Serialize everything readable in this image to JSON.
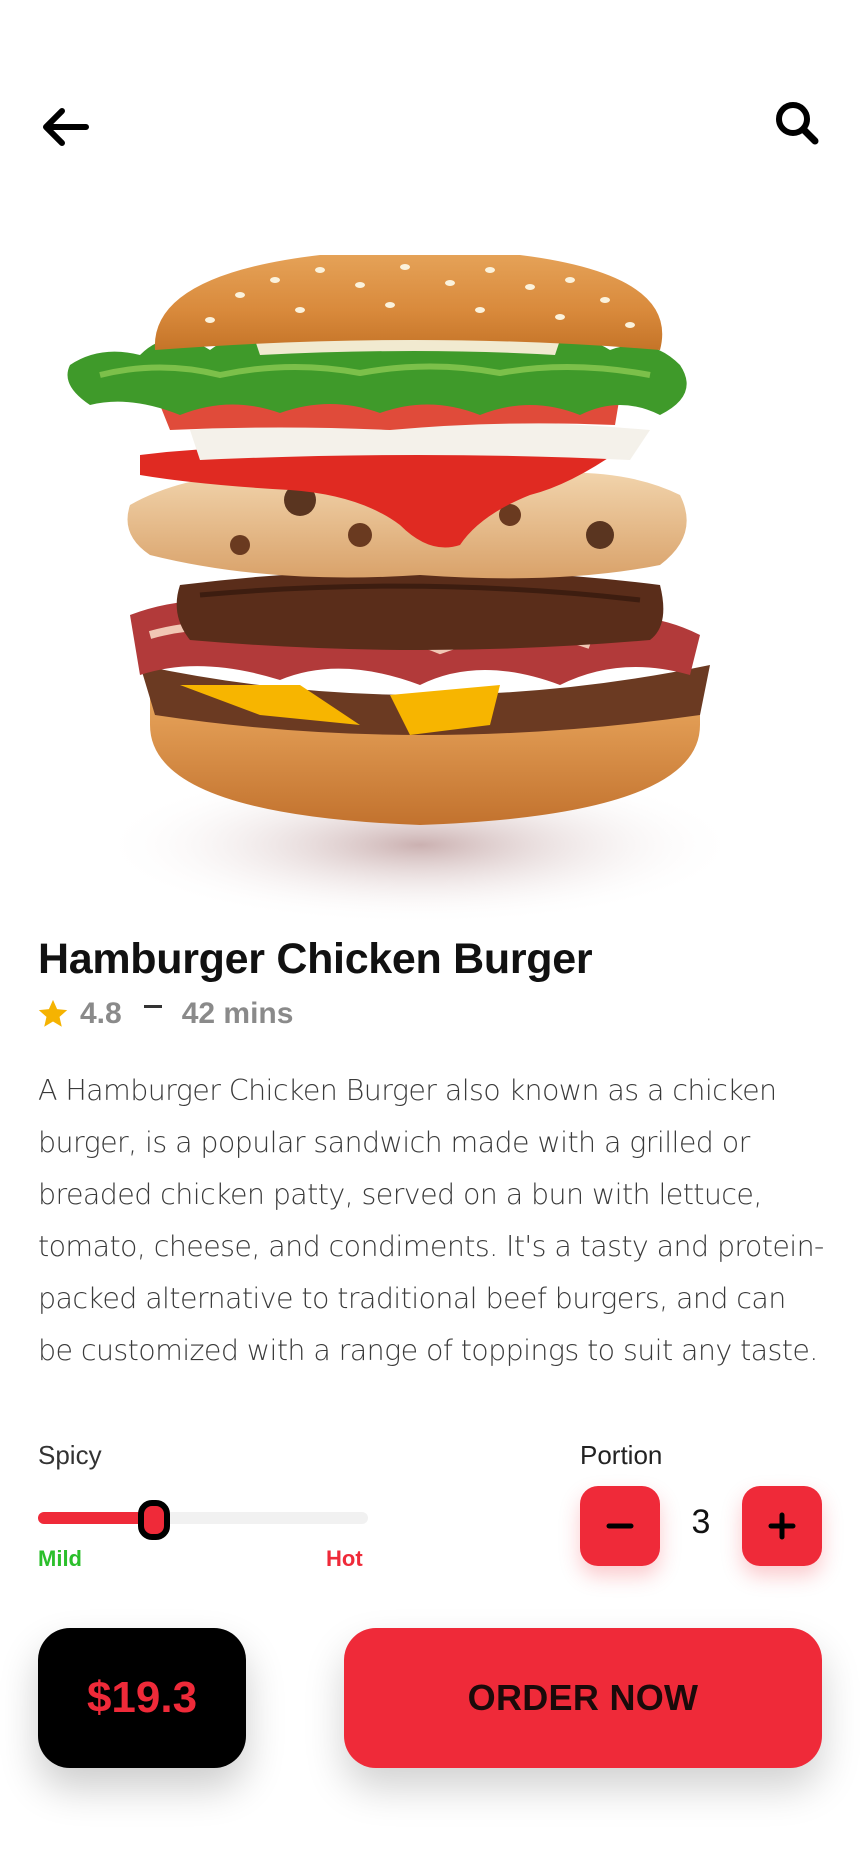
{
  "header": {
    "back_icon": "arrow-left-icon",
    "search_icon": "search-icon"
  },
  "product": {
    "image": "burger-image",
    "name": "Hamburger Chicken Burger",
    "rating": "4.8",
    "time": "42 mins",
    "description": "A Hamburger Chicken Burger also known as a chicken burger, is a popular sandwich made with a grilled or breaded chicken patty, served on a bun with lettuce, tomato, cheese, and condiments. It's a tasty and protein-packed alternative to traditional beef burgers, and can be customized with a range of toppings to suit any taste."
  },
  "spicy": {
    "label": "Spicy",
    "min_label": "Mild",
    "max_label": "Hot",
    "level": 0.35
  },
  "portion": {
    "label": "Portion",
    "quantity": "3"
  },
  "footer": {
    "price": "$19.3",
    "order_label": "ORDER NOW"
  },
  "colors": {
    "accent": "#ef2a39",
    "mild": "#2bbf2b",
    "dark": "#000000"
  }
}
